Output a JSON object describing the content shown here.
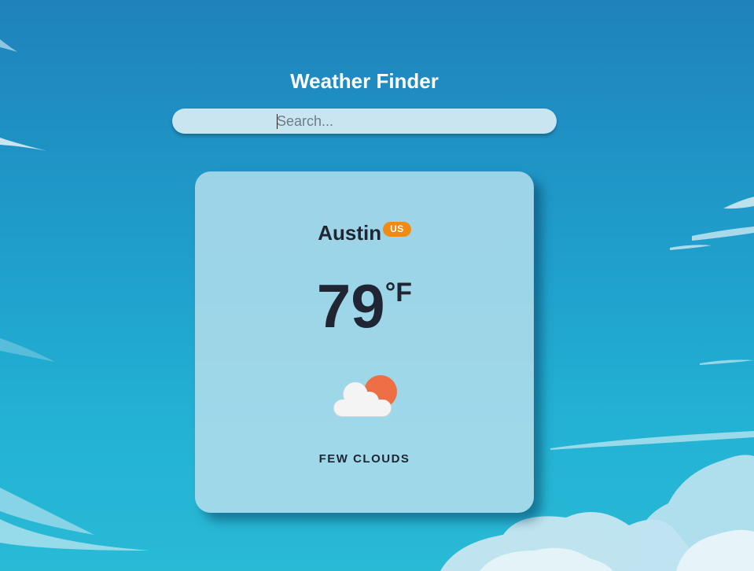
{
  "app": {
    "title": "Weather Finder"
  },
  "search": {
    "value": "",
    "placeholder": "Search..."
  },
  "weather": {
    "city": "Austin",
    "country": "US",
    "temperature": "79",
    "unit": "°F",
    "description": "FEW CLOUDS",
    "icon": "few-clouds-day-icon"
  },
  "colors": {
    "sky_top": "#1f82bb",
    "sky_bottom": "#29bad6",
    "card_background": "#b4deec",
    "country_badge": "#f08a12",
    "text_dark": "#1f2533",
    "sun": "#ee6e45",
    "cloud": "#f2f2f2"
  }
}
